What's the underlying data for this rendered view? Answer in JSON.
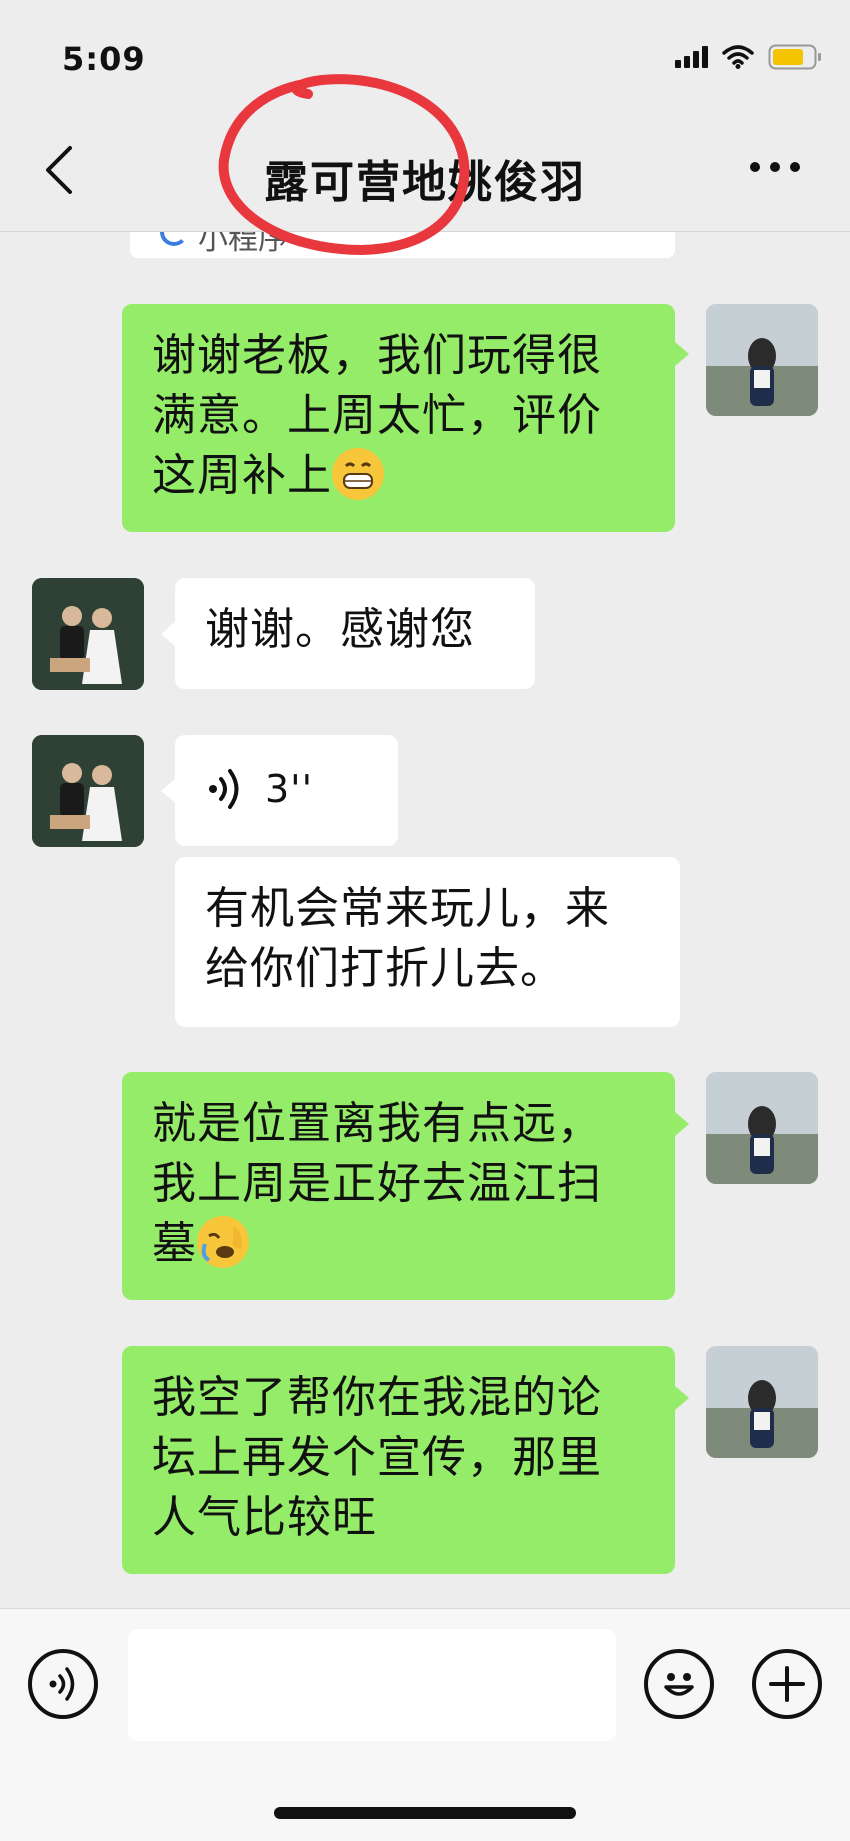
{
  "status_bar": {
    "time": "5:09"
  },
  "header": {
    "title": "露可营地姚俊羽"
  },
  "partial_card": {
    "label": "小程序"
  },
  "messages": [
    {
      "side": "right",
      "type": "text",
      "text": "谢谢老板，我们玩得很满意。上周太忙，评价这周补上",
      "emoji": "grin-emoji"
    },
    {
      "side": "left",
      "type": "text",
      "text": "谢谢。感谢您"
    },
    {
      "side": "left",
      "type": "voice",
      "duration": "3''"
    },
    {
      "side": "left",
      "type": "text",
      "text": "有机会常来玩儿，来给你们打折儿去。"
    },
    {
      "side": "right",
      "type": "text",
      "text": "就是位置离我有点远，我上周是正好去温江扫墓",
      "emoji": "facepalm-emoji"
    },
    {
      "side": "right",
      "type": "text",
      "text": "我空了帮你在我混的论坛上再发个宣传，那里人气比较旺"
    }
  ],
  "input": {
    "value": ""
  },
  "colors": {
    "self_bubble": "#95ec69",
    "other_bubble": "#ffffff",
    "background": "#ededed",
    "annotation": "#e8383d"
  }
}
